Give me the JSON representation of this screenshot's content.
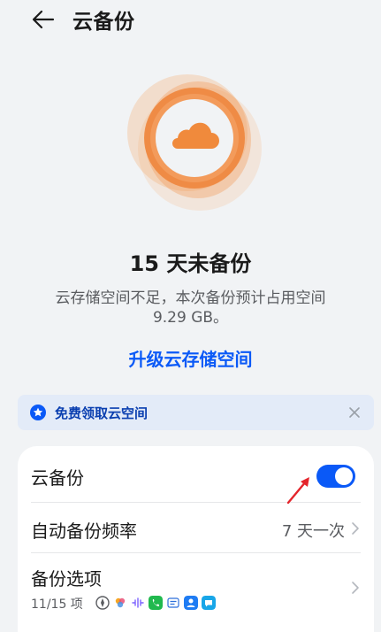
{
  "header": {
    "back_icon": "arrow-left-icon",
    "title": "云备份"
  },
  "status": {
    "cloud_icon": "cloud-icon",
    "days_text": "15 天未备份",
    "description_line1": "云存储空间不足，本次备份预计占用空间",
    "description_line2": "9.29 GB。",
    "upgrade_link": "升级云存储空间"
  },
  "banner": {
    "icon": "star-badge-icon",
    "text": "免费领取云空间",
    "close_icon": "close-icon"
  },
  "settings": {
    "cloud_backup_label": "云备份",
    "cloud_backup_enabled": true,
    "frequency_label": "自动备份频率",
    "frequency_value": "7 天一次",
    "options_label": "备份选项",
    "options_count": "11/15 项",
    "option_app_icons": [
      "compass-app-icon",
      "gallery-app-icon",
      "recorder-app-icon",
      "phone-app-icon",
      "notes-app-icon",
      "contacts-app-icon",
      "messages-app-icon"
    ]
  },
  "colors": {
    "accent_blue": "#0a59f7",
    "cloud_orange": "#f08a3c",
    "background": "#f1f3f5"
  }
}
